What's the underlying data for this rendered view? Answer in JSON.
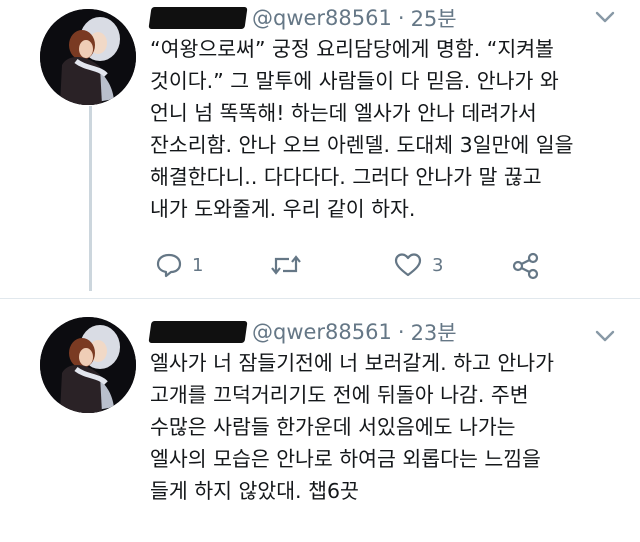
{
  "tweets": [
    {
      "handle": "@qwer88561",
      "separator": "·",
      "time": "25분",
      "lines": [
        "“여왕으로써” 궁정 요리담당에게 명함. “지켜볼",
        "것이다.” 그 말투에 사람들이 다 믿음. 안나가 와",
        "언니 넘 똑똑해! 하는데 엘사가 안나 데려가서",
        "잔소리함. 안나 오브 아렌델. 도대체 3일만에 일을",
        "해결한다니.. 다다다다. 그러다 안나가 말 끊고",
        "내가 도와줄게. 우리 같이 하자."
      ],
      "actions": {
        "reply_icon": "reply-icon",
        "reply_count": "1",
        "retweet_icon": "retweet-icon",
        "like_icon": "heart-icon",
        "like_count": "3",
        "share_icon": "share-icon"
      }
    },
    {
      "handle": "@qwer88561",
      "separator": "·",
      "time": "23분",
      "lines": [
        "엘사가 너 잠들기전에 너 보러갈게. 하고 안나가",
        "고개를 끄덕거리기도 전에 뒤돌아 나감. 주변",
        "수많은 사람들 한가운데 서있음에도 나가는",
        "엘사의 모습은 안나로 하여금 외롭다는 느낌을",
        "들게 하지 않았대. 챕6끗"
      ]
    }
  ],
  "colors": {
    "text": "#14171a",
    "secondary": "#657786",
    "thread_line": "#ccd6dd",
    "divider": "#e1e8ed"
  }
}
